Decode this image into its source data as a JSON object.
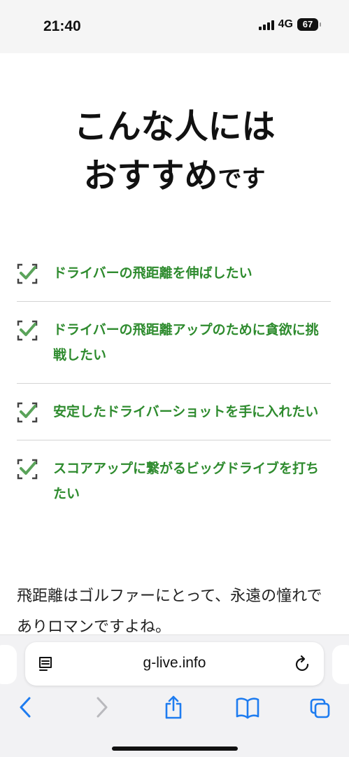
{
  "status_bar": {
    "time": "21:40",
    "network": "4G",
    "battery": "67"
  },
  "headline": {
    "line1": "こんな人には",
    "line2_main": "おすすめ",
    "line2_small": "です"
  },
  "checklist": {
    "items": [
      {
        "label": "ドライバーの飛距離を伸ばしたい"
      },
      {
        "label": "ドライバーの飛距離アップのために貪欲に挑戦したい"
      },
      {
        "label": "安定したドライバーショットを手に入れたい"
      },
      {
        "label": "スコアアップに繋がるビッグドライブを打ちたい"
      }
    ],
    "accent_color": "#2e8b2e"
  },
  "intro": {
    "text": "飛距離はゴルファーにとって、永遠の憧れでありロマンですよね。"
  },
  "browser": {
    "url": "g-live.info",
    "icons": {
      "reader": "reader-mode-icon",
      "reload": "reload-icon",
      "back": "back-chevron-icon",
      "forward": "forward-chevron-icon",
      "share": "share-icon",
      "bookmarks": "bookmarks-icon",
      "tabs": "tabs-icon"
    },
    "accent_color": "#1e7cf0"
  }
}
